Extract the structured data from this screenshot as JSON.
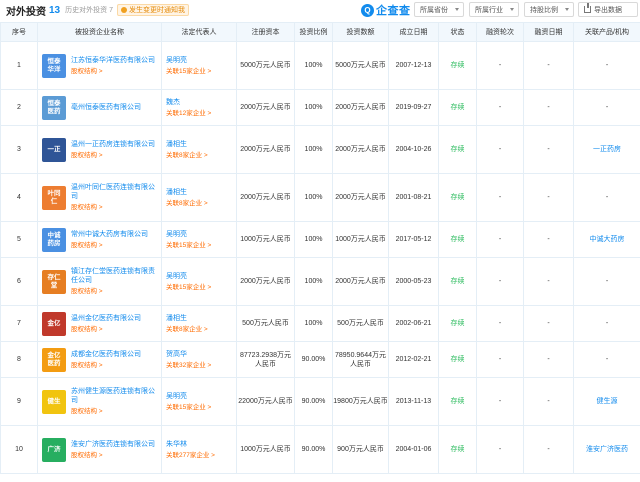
{
  "header": {
    "title": "对外投资",
    "count": "13",
    "history": "历史对外投资 7",
    "badge": "发生变更时通知我"
  },
  "logo_text": "企查查",
  "filters": [
    "所属省份",
    "所属行业",
    "持股比例",
    "导出数据"
  ],
  "columns": [
    "序号",
    "被投资企业名称",
    "法定代表人",
    "注册资本",
    "投资比例",
    "投资数额",
    "成立日期",
    "状态",
    "融资轮次",
    "融资日期",
    "关联产品/机构"
  ],
  "rows": [
    {
      "no": "1",
      "logo": "恒泰\n华洋",
      "color": "#4a90e2",
      "name": "江苏恒泰华洋医药有限公司",
      "tag": "股权结构 >",
      "rep": "吴明亮",
      "rep_link": "关联15家企业 >",
      "capital": "5000万元人民币",
      "ratio": "100%",
      "amount": "5000万元人民币",
      "date": "2007-12-13",
      "status": "存续",
      "round": "-",
      "round_date": "-",
      "product": "-"
    },
    {
      "no": "2",
      "logo": "恒泰\n医药",
      "color": "#5b9bd5",
      "name": "亳州恒泰医药有限公司",
      "tag": "",
      "rep": "魏杰",
      "rep_link": "关联12家企业 >",
      "capital": "2000万元人民币",
      "ratio": "100%",
      "amount": "2000万元人民币",
      "date": "2019-09-27",
      "status": "存续",
      "round": "-",
      "round_date": "-",
      "product": "-"
    },
    {
      "no": "3",
      "logo": "一正",
      "color": "#2f5597",
      "name": "温州一正药房连锁有限公司",
      "tag": "股权结构 >",
      "rep": "潘相生",
      "rep_link": "关联8家企业 >",
      "capital": "2000万元人民币",
      "ratio": "100%",
      "amount": "2000万元人民币",
      "date": "2004-10-26",
      "status": "存续",
      "round": "-",
      "round_date": "-",
      "product": "一正药房"
    },
    {
      "no": "4",
      "logo": "叶同\n仁",
      "color": "#ed7d31",
      "name": "温州叶同仁医药连锁有限公司",
      "tag": "股权结构 >",
      "rep": "潘相生",
      "rep_link": "关联8家企业 >",
      "capital": "2000万元人民币",
      "ratio": "100%",
      "amount": "2000万元人民币",
      "date": "2001-08-21",
      "status": "存续",
      "round": "-",
      "round_date": "-",
      "product": "-"
    },
    {
      "no": "5",
      "logo": "中诚\n药房",
      "color": "#4a90e2",
      "name": "常州中诚大药房有限公司",
      "tag": "股权结构 >",
      "rep": "吴明亮",
      "rep_link": "关联15家企业 >",
      "capital": "1000万元人民币",
      "ratio": "100%",
      "amount": "1000万元人民币",
      "date": "2017-05-12",
      "status": "存续",
      "round": "-",
      "round_date": "-",
      "product": "中诚大药房"
    },
    {
      "no": "6",
      "logo": "存仁\n堂",
      "color": "#e67e22",
      "name": "镇江存仁堂医药连锁有限责任公司",
      "tag": "股权结构 >",
      "rep": "吴明亮",
      "rep_link": "关联15家企业 >",
      "capital": "2000万元人民币",
      "ratio": "100%",
      "amount": "2000万元人民币",
      "date": "2000-05-23",
      "status": "存续",
      "round": "-",
      "round_date": "-",
      "product": "-"
    },
    {
      "no": "7",
      "logo": "金亿",
      "color": "#c0392b",
      "name": "温州金亿医药有限公司",
      "tag": "股权结构 >",
      "rep": "潘相生",
      "rep_link": "关联8家企业 >",
      "capital": "500万元人民币",
      "ratio": "100%",
      "amount": "500万元人民币",
      "date": "2002-06-21",
      "status": "存续",
      "round": "-",
      "round_date": "-",
      "product": "-"
    },
    {
      "no": "8",
      "logo": "金亿\n医药",
      "color": "#f39c12",
      "name": "成都金亿医药有限公司",
      "tag": "股权结构 >",
      "rep": "贺高华",
      "rep_link": "关联32家企业 >",
      "capital": "87723.2938万元人民币",
      "ratio": "90.00%",
      "amount": "78950.9644万元人民币",
      "date": "2012-02-21",
      "status": "存续",
      "round": "-",
      "round_date": "-",
      "product": "-"
    },
    {
      "no": "9",
      "logo": "健生",
      "color": "#f1c40f",
      "name": "苏州健生源医药连锁有限公司",
      "tag": "股权结构 >",
      "rep": "吴明亮",
      "rep_link": "关联15家企业 >",
      "capital": "22000万元人民币",
      "ratio": "90.00%",
      "amount": "19800万元人民币",
      "date": "2013-11-13",
      "status": "存续",
      "round": "-",
      "round_date": "-",
      "product": "健生源"
    },
    {
      "no": "10",
      "logo": "广济",
      "color": "#27ae60",
      "name": "淮安广济医药连锁有限公司",
      "tag": "股权结构 >",
      "rep": "朱华林",
      "rep_link": "关联277家企业 >",
      "capital": "1000万元人民币",
      "ratio": "90.00%",
      "amount": "900万元人民币",
      "date": "2004-01-06",
      "status": "存续",
      "round": "-",
      "round_date": "-",
      "product": "淮安广济医药"
    }
  ]
}
